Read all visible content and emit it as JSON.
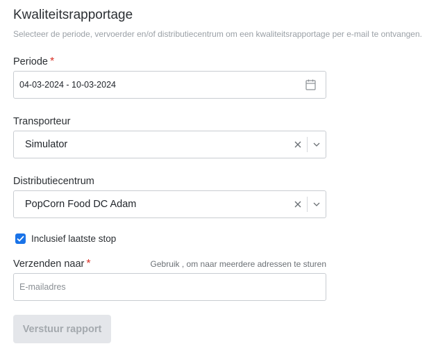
{
  "header": {
    "title": "Kwaliteitsrapportage",
    "subtitle": "Selecteer de periode, vervoerder en/of distributiecentrum om een kwaliteitsrapportage per e-mail te ontvangen."
  },
  "periode": {
    "label": "Periode",
    "required_marker": "*",
    "value": "04-03-2024 - 10-03-2024",
    "icon": "calendar-icon"
  },
  "transporteur": {
    "label": "Transporteur",
    "value": "Simulator",
    "clear_icon": "close-icon",
    "dropdown_icon": "chevron-down-icon"
  },
  "distributiecentrum": {
    "label": "Distributiecentrum",
    "value": "PopCorn Food DC Adam",
    "clear_icon": "close-icon",
    "dropdown_icon": "chevron-down-icon"
  },
  "inclusief": {
    "label": "Inclusief laatste stop",
    "checked": true
  },
  "verzenden": {
    "label": "Verzenden naar",
    "required_marker": "*",
    "hint": "Gebruik , om naar meerdere adressen te sturen",
    "placeholder": "E-mailadres",
    "value": ""
  },
  "submit": {
    "label": "Verstuur rapport",
    "disabled": true
  },
  "colors": {
    "accent": "#1a73e8",
    "required": "#d93025",
    "border": "#c8ccd1",
    "disabled_bg": "#e4e6ea",
    "disabled_text": "#a4a9ae"
  }
}
